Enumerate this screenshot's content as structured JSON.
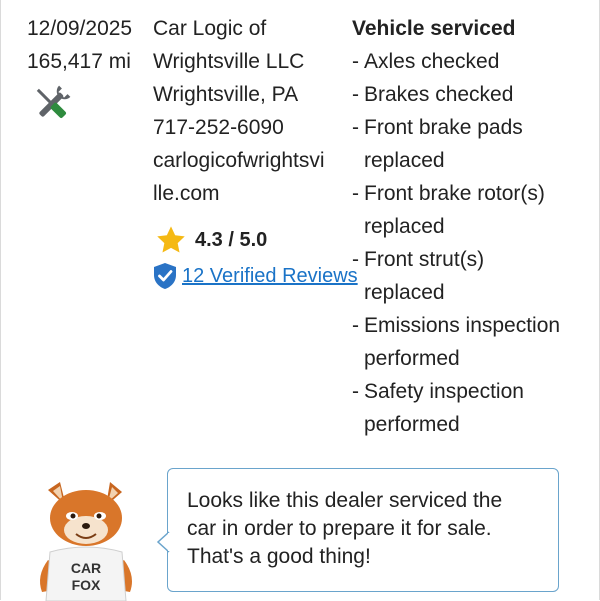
{
  "record": {
    "date": "12/09/2025",
    "mileage": "165,417 mi",
    "icon": "tools-icon"
  },
  "dealer": {
    "name_lines": [
      "Car Logic of",
      "Wrightsville LLC"
    ],
    "city": "Wrightsville, PA",
    "phone": "717-252-6090",
    "website_lines": [
      "carlogicofwrightsvi",
      "lle.com"
    ],
    "rating": "4.3 / 5.0",
    "reviews_link": "12 Verified Reviews"
  },
  "service": {
    "title": "Vehicle serviced",
    "items": [
      [
        "Axles checked"
      ],
      [
        "Brakes checked"
      ],
      [
        "Front brake pads",
        "replaced"
      ],
      [
        "Front brake rotor(s)",
        "replaced"
      ],
      [
        "Front strut(s)",
        "replaced"
      ],
      [
        "Emissions inspection",
        "performed"
      ],
      [
        "Safety inspection",
        "performed"
      ]
    ]
  },
  "fox": {
    "shirt_lines": [
      "CAR",
      "FOX"
    ]
  },
  "callout": {
    "lines": [
      "Looks like this dealer serviced the",
      "car in order to prepare it for sale.",
      "That's a good thing!"
    ]
  },
  "colors": {
    "link": "#1a73c7",
    "star": "#f5b914",
    "shield": "#2a73c5",
    "bubble_border": "#6aa4cc"
  }
}
